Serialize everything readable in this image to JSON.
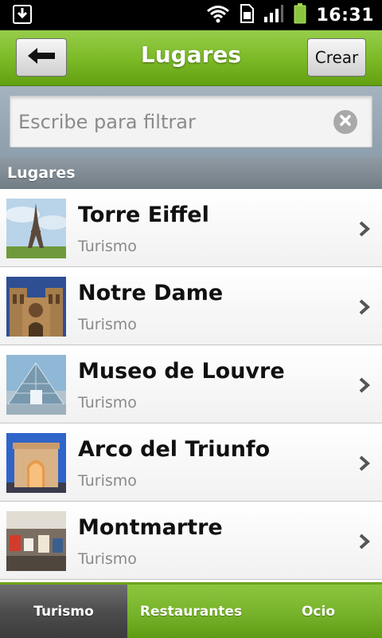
{
  "status_bar": {
    "time": "16:31",
    "icons": [
      "download-icon",
      "wifi-icon",
      "sim-icon",
      "signal-icon",
      "battery-icon"
    ]
  },
  "action_bar": {
    "title": "Lugares",
    "back_icon": "arrow-left-icon",
    "create_label": "Crear"
  },
  "search": {
    "placeholder": "Escribe para filtrar",
    "value": "",
    "clear_icon": "clear-icon"
  },
  "section": {
    "title": "Lugares"
  },
  "places": [
    {
      "name": "Torre Eiffel",
      "category": "Turismo",
      "thumb": "eiffel-tower"
    },
    {
      "name": "Notre Dame",
      "category": "Turismo",
      "thumb": "notre-dame"
    },
    {
      "name": "Museo de Louvre",
      "category": "Turismo",
      "thumb": "louvre-pyramid"
    },
    {
      "name": "Arco del Triunfo",
      "category": "Turismo",
      "thumb": "arc-de-triomphe"
    },
    {
      "name": "Montmartre",
      "category": "Turismo",
      "thumb": "montmartre"
    }
  ],
  "tabs": [
    {
      "label": "Turismo",
      "active": true
    },
    {
      "label": "Restaurantes",
      "active": false
    },
    {
      "label": "Ocio",
      "active": false
    }
  ],
  "colors": {
    "accent_green": "#7dbb28",
    "active_tab": "#4d4d4d",
    "section_header": "#7f8a93"
  }
}
